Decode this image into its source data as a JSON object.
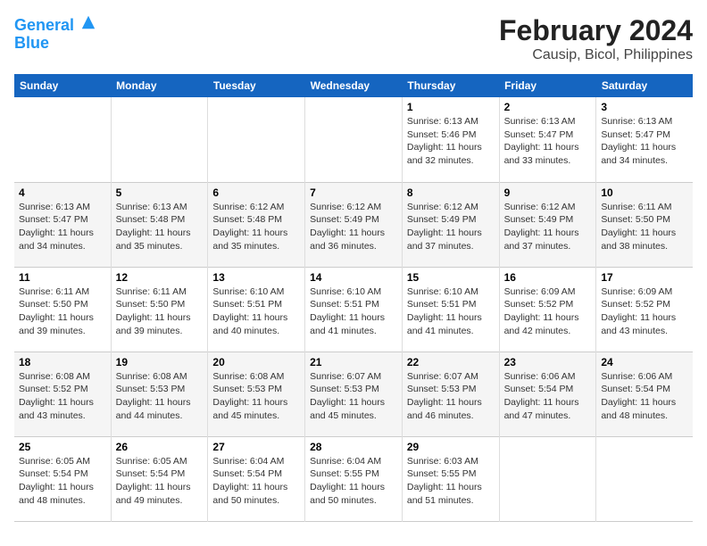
{
  "logo": {
    "line1": "General",
    "line2": "Blue"
  },
  "title": "February 2024",
  "subtitle": "Causip, Bicol, Philippines",
  "days_of_week": [
    "Sunday",
    "Monday",
    "Tuesday",
    "Wednesday",
    "Thursday",
    "Friday",
    "Saturday"
  ],
  "weeks": [
    [
      {
        "num": "",
        "info": ""
      },
      {
        "num": "",
        "info": ""
      },
      {
        "num": "",
        "info": ""
      },
      {
        "num": "",
        "info": ""
      },
      {
        "num": "1",
        "info": "Sunrise: 6:13 AM\nSunset: 5:46 PM\nDaylight: 11 hours\nand 32 minutes."
      },
      {
        "num": "2",
        "info": "Sunrise: 6:13 AM\nSunset: 5:47 PM\nDaylight: 11 hours\nand 33 minutes."
      },
      {
        "num": "3",
        "info": "Sunrise: 6:13 AM\nSunset: 5:47 PM\nDaylight: 11 hours\nand 34 minutes."
      }
    ],
    [
      {
        "num": "4",
        "info": "Sunrise: 6:13 AM\nSunset: 5:47 PM\nDaylight: 11 hours\nand 34 minutes."
      },
      {
        "num": "5",
        "info": "Sunrise: 6:13 AM\nSunset: 5:48 PM\nDaylight: 11 hours\nand 35 minutes."
      },
      {
        "num": "6",
        "info": "Sunrise: 6:12 AM\nSunset: 5:48 PM\nDaylight: 11 hours\nand 35 minutes."
      },
      {
        "num": "7",
        "info": "Sunrise: 6:12 AM\nSunset: 5:49 PM\nDaylight: 11 hours\nand 36 minutes."
      },
      {
        "num": "8",
        "info": "Sunrise: 6:12 AM\nSunset: 5:49 PM\nDaylight: 11 hours\nand 37 minutes."
      },
      {
        "num": "9",
        "info": "Sunrise: 6:12 AM\nSunset: 5:49 PM\nDaylight: 11 hours\nand 37 minutes."
      },
      {
        "num": "10",
        "info": "Sunrise: 6:11 AM\nSunset: 5:50 PM\nDaylight: 11 hours\nand 38 minutes."
      }
    ],
    [
      {
        "num": "11",
        "info": "Sunrise: 6:11 AM\nSunset: 5:50 PM\nDaylight: 11 hours\nand 39 minutes."
      },
      {
        "num": "12",
        "info": "Sunrise: 6:11 AM\nSunset: 5:50 PM\nDaylight: 11 hours\nand 39 minutes."
      },
      {
        "num": "13",
        "info": "Sunrise: 6:10 AM\nSunset: 5:51 PM\nDaylight: 11 hours\nand 40 minutes."
      },
      {
        "num": "14",
        "info": "Sunrise: 6:10 AM\nSunset: 5:51 PM\nDaylight: 11 hours\nand 41 minutes."
      },
      {
        "num": "15",
        "info": "Sunrise: 6:10 AM\nSunset: 5:51 PM\nDaylight: 11 hours\nand 41 minutes."
      },
      {
        "num": "16",
        "info": "Sunrise: 6:09 AM\nSunset: 5:52 PM\nDaylight: 11 hours\nand 42 minutes."
      },
      {
        "num": "17",
        "info": "Sunrise: 6:09 AM\nSunset: 5:52 PM\nDaylight: 11 hours\nand 43 minutes."
      }
    ],
    [
      {
        "num": "18",
        "info": "Sunrise: 6:08 AM\nSunset: 5:52 PM\nDaylight: 11 hours\nand 43 minutes."
      },
      {
        "num": "19",
        "info": "Sunrise: 6:08 AM\nSunset: 5:53 PM\nDaylight: 11 hours\nand 44 minutes."
      },
      {
        "num": "20",
        "info": "Sunrise: 6:08 AM\nSunset: 5:53 PM\nDaylight: 11 hours\nand 45 minutes."
      },
      {
        "num": "21",
        "info": "Sunrise: 6:07 AM\nSunset: 5:53 PM\nDaylight: 11 hours\nand 45 minutes."
      },
      {
        "num": "22",
        "info": "Sunrise: 6:07 AM\nSunset: 5:53 PM\nDaylight: 11 hours\nand 46 minutes."
      },
      {
        "num": "23",
        "info": "Sunrise: 6:06 AM\nSunset: 5:54 PM\nDaylight: 11 hours\nand 47 minutes."
      },
      {
        "num": "24",
        "info": "Sunrise: 6:06 AM\nSunset: 5:54 PM\nDaylight: 11 hours\nand 48 minutes."
      }
    ],
    [
      {
        "num": "25",
        "info": "Sunrise: 6:05 AM\nSunset: 5:54 PM\nDaylight: 11 hours\nand 48 minutes."
      },
      {
        "num": "26",
        "info": "Sunrise: 6:05 AM\nSunset: 5:54 PM\nDaylight: 11 hours\nand 49 minutes."
      },
      {
        "num": "27",
        "info": "Sunrise: 6:04 AM\nSunset: 5:54 PM\nDaylight: 11 hours\nand 50 minutes."
      },
      {
        "num": "28",
        "info": "Sunrise: 6:04 AM\nSunset: 5:55 PM\nDaylight: 11 hours\nand 50 minutes."
      },
      {
        "num": "29",
        "info": "Sunrise: 6:03 AM\nSunset: 5:55 PM\nDaylight: 11 hours\nand 51 minutes."
      },
      {
        "num": "",
        "info": ""
      },
      {
        "num": "",
        "info": ""
      }
    ]
  ]
}
